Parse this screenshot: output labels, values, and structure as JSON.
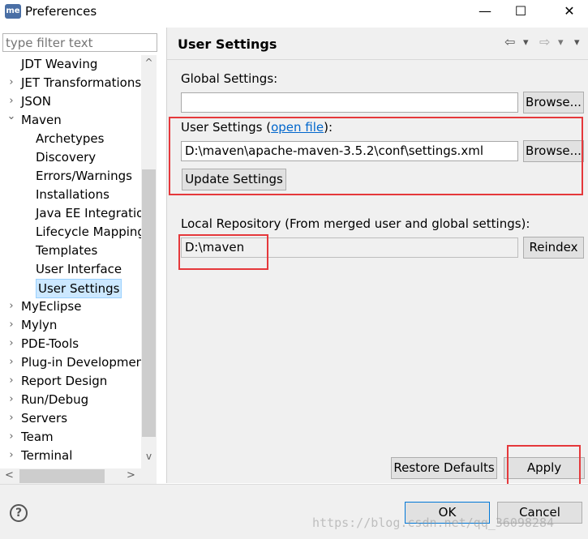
{
  "window": {
    "app_icon": "me",
    "title": "Preferences",
    "minimize_glyph": "—",
    "maximize_glyph": "☐",
    "close_glyph": "✕"
  },
  "filter": {
    "placeholder": "type filter text"
  },
  "tree": {
    "items": [
      {
        "label": "JDT Weaving",
        "arrow": ""
      },
      {
        "label": "JET Transformations",
        "arrow": "›"
      },
      {
        "label": "JSON",
        "arrow": "›"
      },
      {
        "label": "Maven",
        "arrow": "⌄"
      },
      {
        "label": "Archetypes",
        "arrow": ""
      },
      {
        "label": "Discovery",
        "arrow": ""
      },
      {
        "label": "Errors/Warnings",
        "arrow": ""
      },
      {
        "label": "Installations",
        "arrow": ""
      },
      {
        "label": "Java EE Integration",
        "arrow": ""
      },
      {
        "label": "Lifecycle Mappings",
        "arrow": ""
      },
      {
        "label": "Templates",
        "arrow": ""
      },
      {
        "label": "User Interface",
        "arrow": ""
      },
      {
        "label": "User Settings",
        "arrow": ""
      },
      {
        "label": "MyEclipse",
        "arrow": "›"
      },
      {
        "label": "Mylyn",
        "arrow": "›"
      },
      {
        "label": "PDE-Tools",
        "arrow": "›"
      },
      {
        "label": "Plug-in Development",
        "arrow": "›"
      },
      {
        "label": "Report Design",
        "arrow": "›"
      },
      {
        "label": "Run/Debug",
        "arrow": "›"
      },
      {
        "label": "Servers",
        "arrow": "›"
      },
      {
        "label": "Team",
        "arrow": "›"
      },
      {
        "label": "Terminal",
        "arrow": "›"
      }
    ],
    "selected_label": "User Settings",
    "scroll_up": "^",
    "scroll_down": "v",
    "scroll_left": "<",
    "scroll_right": ">"
  },
  "page": {
    "title": "User Settings",
    "nav_back": "⇦",
    "nav_back_menu": "▾",
    "nav_forward": "⇨",
    "nav_forward_menu": "▾",
    "global_settings_label": "Global Settings:",
    "global_settings_value": "",
    "browse_label": "Browse...",
    "user_settings_label_prefix": "User Settings (",
    "open_file_link": "open file",
    "user_settings_label_suffix": "):",
    "user_settings_value": "D:\\maven\\apache-maven-3.5.2\\conf\\settings.xml",
    "update_settings_label": "Update Settings",
    "local_repo_label": "Local Repository (From merged user and global settings):",
    "local_repo_value": "D:\\maven",
    "reindex_label": "Reindex",
    "restore_defaults_label": "Restore Defaults",
    "apply_label": "Apply"
  },
  "footer": {
    "help_glyph": "?",
    "ok_label": "OK",
    "cancel_label": "Cancel",
    "watermark": "https://blog.csdn.net/qq_36098284"
  },
  "colors": {
    "highlight_box": "#e5383b",
    "selection": "#cce8ff",
    "link": "#0066cc",
    "panel_bg": "#f0f0f0"
  }
}
